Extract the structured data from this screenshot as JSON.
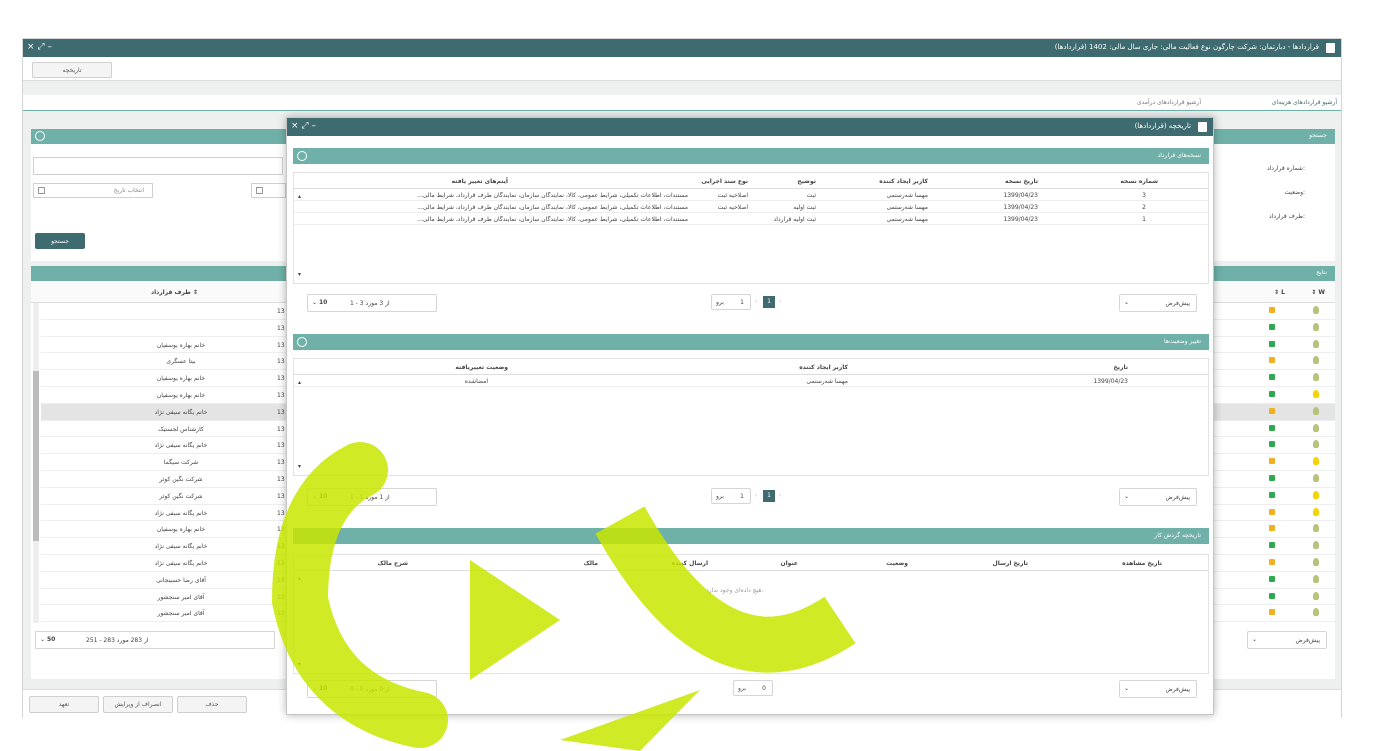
{
  "main_window": {
    "title": "قراردادها - دبارتمان: شرکت چارگون نوع فعالیت مالی: جاری سال مالی: 1402 (قراردادها)",
    "toolbar_button": "تاریخچه",
    "tabs": [
      "آرشیو قراردادهای هزینه‌ای",
      "آرشیو قراردادهای درآمدی"
    ],
    "search_section": "جستجو",
    "filter_labels": [
      "شماره قرارداد:",
      "وضعیت:",
      "طرف قرارداد:"
    ],
    "date_placeholder": "انتخاب تاریخ",
    "search_button": "جستجو",
    "results_section": "نتایج",
    "grid_headers": {
      "party": "طرف قرارداد",
      "l": "L",
      "w": "W"
    },
    "grid_rows": [
      {
        "party": "",
        "num": "13"
      },
      {
        "party": "",
        "num": "13"
      },
      {
        "party": "خانم بهاره یوسفیان",
        "num": "13"
      },
      {
        "party": "بیتا عسگری",
        "num": "13"
      },
      {
        "party": "خانم بهاره یوسفیان",
        "num": "13"
      },
      {
        "party": "خانم بهاره یوسفیان",
        "num": "13"
      },
      {
        "party": "خانم یگانه سیفی نژاد",
        "num": "13"
      },
      {
        "party": "کارشناس لجستیک",
        "num": "13"
      },
      {
        "party": "خانم یگانه سیفی نژاد",
        "num": "13"
      },
      {
        "party": "شرکت سیگما",
        "num": "13"
      },
      {
        "party": "شرکت نگین کوثر",
        "num": "13"
      },
      {
        "party": "شرکت نگین کوثر",
        "num": "13"
      },
      {
        "party": "خانم یگانه سیفی نژاد",
        "num": "13"
      },
      {
        "party": "خانم بهاره یوسفیان",
        "num": "13"
      },
      {
        "party": "خانم یگانه سیفی نژاد",
        "num": "13"
      },
      {
        "party": "خانم یگانه سیفی نژاد",
        "num": "13"
      },
      {
        "party": "آقای رضا حسینجانی",
        "num": "13"
      },
      {
        "party": "آقای امیر سنجشور",
        "num": "13"
      },
      {
        "party": "آقای امیر سنجشور",
        "num": "13"
      }
    ],
    "pager": {
      "range": "251 - 283 از 283 مورد",
      "page_size": "50",
      "default": "پیش‌فرض"
    },
    "bottom_buttons": [
      "تعهد",
      "انصراف از ویرایش",
      "حذف"
    ]
  },
  "dialog": {
    "title": "تاریخچه (قراردادها)",
    "versions": {
      "section": "نسخه‌های قرارداد",
      "headers": [
        "شماره نسخه",
        "تاریخ نسخه",
        "کاربر ایجاد کننده",
        "توضیح",
        "نوع سند اجرایی",
        "آیتم‌های تغییر یافته"
      ],
      "rows": [
        [
          "3",
          "1399/04/23",
          "مهسا شه‌رستمی",
          "ثبت",
          "اصلاحیه ثبت",
          "مستندات، اطلاعات تکمیلی، شرایط عمومی، کالا، نمایندگان سازمان، نمایندگان طرف قرارداد، شرایط مالی..."
        ],
        [
          "2",
          "1399/04/23",
          "مهسا شه‌رستمی",
          "ثبت اولیه",
          "اصلاحیه ثبت",
          "مستندات، اطلاعات تکمیلی، شرایط عمومی، کالا، نمایندگان سازمان، نمایندگان طرف قرارداد، شرایط مالی..."
        ],
        [
          "1",
          "1399/04/23",
          "مهسا شه‌رستمی",
          "ثبت اولیه قرارداد",
          "",
          "مستندات، اطلاعات تکمیلی، شرایط عمومی، کالا، نمایندگان سازمان، نمایندگان طرف قرارداد، شرایط مالی..."
        ]
      ],
      "pager": {
        "range": "1 - 3 از 3 مورد",
        "page_size": "10",
        "goto_label": "برو",
        "goto_value": "1",
        "page": "1",
        "default": "پیش‌فرض"
      }
    },
    "status_changes": {
      "section": "تغییر وضعیت‌ها",
      "headers": [
        "تاریخ",
        "کاربر ایجاد کننده",
        "وضعیت تغییریافته"
      ],
      "rows": [
        [
          "1399/04/23",
          "مهسا شه‌رستمی",
          "امضاشده"
        ]
      ],
      "pager": {
        "range": "1 - 1 از 1 مورد",
        "page_size": "10",
        "goto_label": "برو",
        "goto_value": "1",
        "page": "1",
        "default": "پیش‌فرض"
      }
    },
    "workflow": {
      "section": "تاریخچه گردش کار",
      "headers": [
        "تاریخ مشاهده",
        "تاریخ ارسال",
        "وضعیت",
        "عنوان",
        "ارسال کننده",
        "مالک",
        "شرح مالک"
      ],
      "empty": "هیچ داده‌ای وجود ندارد.",
      "pager": {
        "range": "0 - 0 از 0 مورد",
        "page_size": "10",
        "goto_label": "برو",
        "goto_value": "0",
        "default": "پیش‌فرض"
      }
    }
  },
  "colors": {
    "titlebar": "#3d6b6f",
    "section": "#6fb1a8",
    "watermark": "#c8e600"
  }
}
